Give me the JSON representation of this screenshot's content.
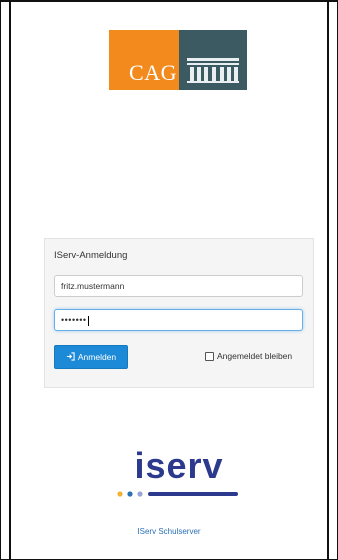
{
  "logo": {
    "text": "CAG",
    "orange": "#f28a1e",
    "teal": "#3c5a62"
  },
  "login": {
    "title": "IServ-Anmeldung",
    "username_value": "fritz.mustermann",
    "password_mask": "•••••••",
    "button_label": "Anmelden",
    "button_icon": "sign-in-icon",
    "remember_label": "Angemeldet bleiben",
    "remember_checked": false,
    "accent": "#1c8ad6"
  },
  "brand": {
    "name": "iserv",
    "color": "#2b3a8c",
    "dot_colors": [
      "#f2b233",
      "#2b6fb5",
      "#9aa6d6"
    ]
  },
  "footer": {
    "link_text": "IServ Schulserver"
  }
}
